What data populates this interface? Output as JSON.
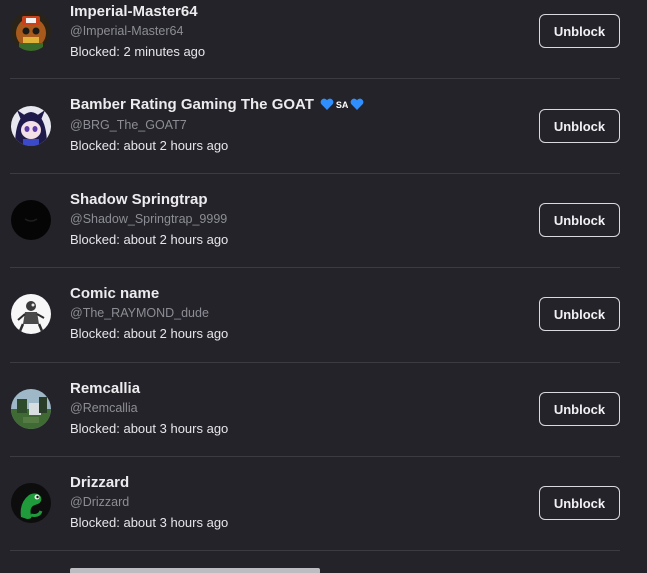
{
  "blocked_users": [
    {
      "display_name": "Imperial-Master64",
      "username": "@Imperial-Master64",
      "blocked_time": "Blocked: 2 minutes ago",
      "unblock_label": "Unblock",
      "avatar_icon": "orange-character-avatar-icon"
    },
    {
      "display_name": "Bamber Rating Gaming The GOAT",
      "badge_text": "SA",
      "username": "@BRG_The_GOAT7",
      "blocked_time": "Blocked: about 2 hours ago",
      "unblock_label": "Unblock",
      "avatar_icon": "anime-character-avatar-icon"
    },
    {
      "display_name": "Shadow Springtrap",
      "username": "@Shadow_Springtrap_9999",
      "blocked_time": "Blocked: about 2 hours ago",
      "unblock_label": "Unblock",
      "avatar_icon": "black-avatar-icon"
    },
    {
      "display_name": "Comic name",
      "username": "@The_RAYMOND_dude",
      "blocked_time": "Blocked: about 2 hours ago",
      "unblock_label": "Unblock",
      "avatar_icon": "white-sketch-avatar-icon"
    },
    {
      "display_name": "Remcallia",
      "username": "@Remcallia",
      "blocked_time": "Blocked: about 3 hours ago",
      "unblock_label": "Unblock",
      "avatar_icon": "landscape-avatar-icon"
    },
    {
      "display_name": "Drizzard",
      "username": "@Drizzard",
      "blocked_time": "Blocked: about 3 hours ago",
      "unblock_label": "Unblock",
      "avatar_icon": "green-lizard-avatar-icon"
    }
  ],
  "colors": {
    "background": "#232329",
    "divider": "#3b3b43",
    "badge_heart": "#2f8fff",
    "handle_text": "#8d8d95"
  }
}
